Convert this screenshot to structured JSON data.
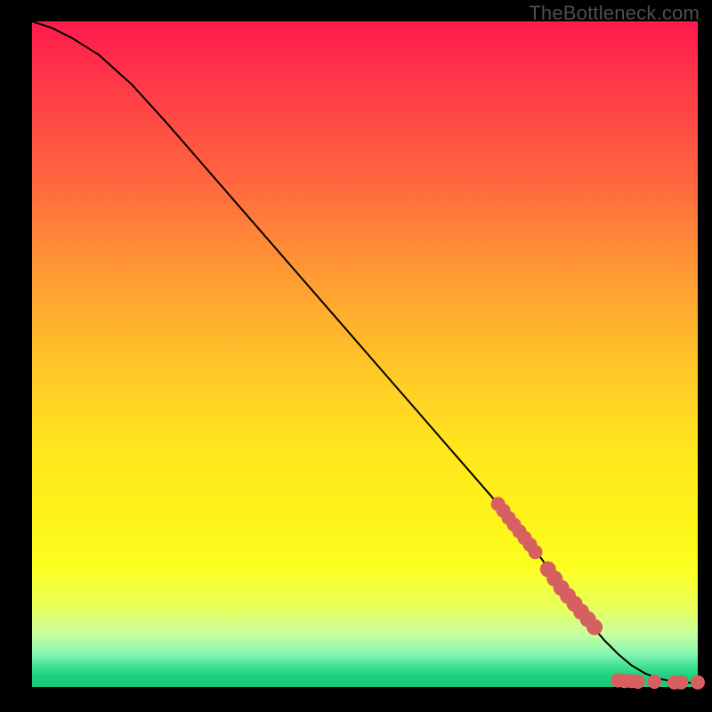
{
  "watermark": "TheBottleneck.com",
  "chart_data": {
    "type": "line",
    "title": "",
    "xlabel": "",
    "ylabel": "",
    "xlim": [
      0,
      100
    ],
    "ylim": [
      0,
      100
    ],
    "grid": false,
    "legend": false,
    "series": [
      {
        "name": "curve",
        "stroke": "#000000",
        "x": [
          0,
          3,
          6,
          10,
          15,
          20,
          30,
          40,
          50,
          60,
          70,
          76,
          80,
          83,
          86,
          88,
          90,
          92,
          94,
          96,
          98,
          100
        ],
        "y": [
          100,
          99,
          97.5,
          95,
          90.5,
          85,
          73.5,
          62,
          50.5,
          39,
          27.5,
          20,
          14.5,
          10.5,
          7,
          5,
          3.3,
          2.1,
          1.3,
          0.9,
          0.7,
          0.6
        ]
      }
    ],
    "markers": [
      {
        "name": "cluster-upper",
        "color": "#d6605f",
        "r": 8,
        "points": [
          {
            "x": 70.0,
            "y": 27.5
          },
          {
            "x": 70.8,
            "y": 26.5
          },
          {
            "x": 71.6,
            "y": 25.4
          },
          {
            "x": 72.4,
            "y": 24.4
          },
          {
            "x": 73.2,
            "y": 23.4
          },
          {
            "x": 74.0,
            "y": 22.4
          },
          {
            "x": 74.8,
            "y": 21.4
          },
          {
            "x": 75.6,
            "y": 20.3
          }
        ]
      },
      {
        "name": "cluster-mid",
        "color": "#d6605f",
        "r": 9,
        "points": [
          {
            "x": 77.5,
            "y": 17.7
          },
          {
            "x": 78.5,
            "y": 16.3
          },
          {
            "x": 79.5,
            "y": 14.9
          },
          {
            "x": 80.5,
            "y": 13.7
          },
          {
            "x": 81.5,
            "y": 12.5
          },
          {
            "x": 82.5,
            "y": 11.3
          },
          {
            "x": 83.5,
            "y": 10.2
          },
          {
            "x": 84.5,
            "y": 9.0
          }
        ]
      },
      {
        "name": "cluster-lower-tail",
        "color": "#d6605f",
        "r": 8,
        "points": [
          {
            "x": 88.0,
            "y": 1.0
          },
          {
            "x": 89.0,
            "y": 0.9
          },
          {
            "x": 90.0,
            "y": 0.9
          },
          {
            "x": 91.0,
            "y": 0.8
          },
          {
            "x": 93.5,
            "y": 0.8
          },
          {
            "x": 96.5,
            "y": 0.7
          },
          {
            "x": 97.5,
            "y": 0.7
          },
          {
            "x": 100.0,
            "y": 0.7
          }
        ]
      }
    ],
    "background_gradient_stops": [
      {
        "pos": 0.0,
        "color": "#ff1a4d"
      },
      {
        "pos": 0.1,
        "color": "#ff3b47"
      },
      {
        "pos": 0.25,
        "color": "#ff6a3e"
      },
      {
        "pos": 0.38,
        "color": "#ff9a33"
      },
      {
        "pos": 0.52,
        "color": "#ffc728"
      },
      {
        "pos": 0.64,
        "color": "#ffe61e"
      },
      {
        "pos": 0.74,
        "color": "#fff21a"
      },
      {
        "pos": 0.82,
        "color": "#fcff1f"
      },
      {
        "pos": 0.88,
        "color": "#e8ff5a"
      },
      {
        "pos": 0.92,
        "color": "#c8ffa0"
      },
      {
        "pos": 0.95,
        "color": "#86f7b3"
      },
      {
        "pos": 0.97,
        "color": "#3ee08f"
      },
      {
        "pos": 0.983,
        "color": "#1cd07f"
      },
      {
        "pos": 1.0,
        "color": "#17c97a"
      }
    ]
  }
}
